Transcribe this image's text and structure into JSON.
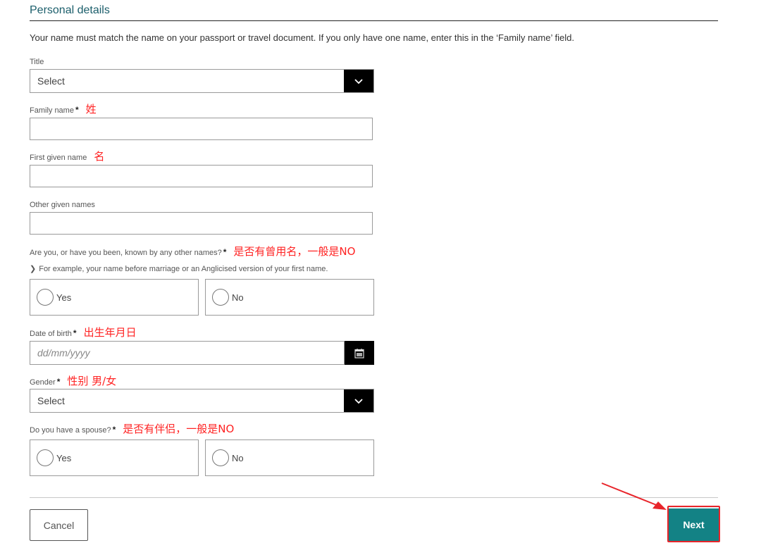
{
  "section": {
    "title": "Personal details",
    "intro": "Your name must match the name on your passport or travel document. If you only have one name, enter this in the ‘Family name’ field."
  },
  "fields": {
    "title": {
      "label": "Title",
      "value": "Select"
    },
    "family_name": {
      "label": "Family name",
      "required": "*",
      "note": "姓",
      "value": ""
    },
    "first_given_name": {
      "label": "First given name",
      "note": "名",
      "value": ""
    },
    "other_given_names": {
      "label": "Other given names",
      "value": ""
    },
    "other_names": {
      "label": "Are you, or have you been, known by any other names?",
      "required": "*",
      "note": "是否有曾用名，一般是NO",
      "hint": "For example, your name before marriage or an Anglicised version of your first name.",
      "options": [
        "Yes",
        "No"
      ]
    },
    "dob": {
      "label": "Date of birth",
      "required": "*",
      "note": "出生年月日",
      "placeholder": "dd/mm/yyyy"
    },
    "gender": {
      "label": "Gender",
      "required": "*",
      "note": "性别  男/女",
      "value": "Select"
    },
    "spouse": {
      "label": "Do you have a spouse?",
      "required": "*",
      "note": "是否有伴侣，一般是NO",
      "options": [
        "Yes",
        "No"
      ]
    }
  },
  "actions": {
    "cancel": "Cancel",
    "next": "Next"
  },
  "colors": {
    "accent": "#138285",
    "annotation": "#e8242a",
    "heading": "#1b5e6b"
  }
}
